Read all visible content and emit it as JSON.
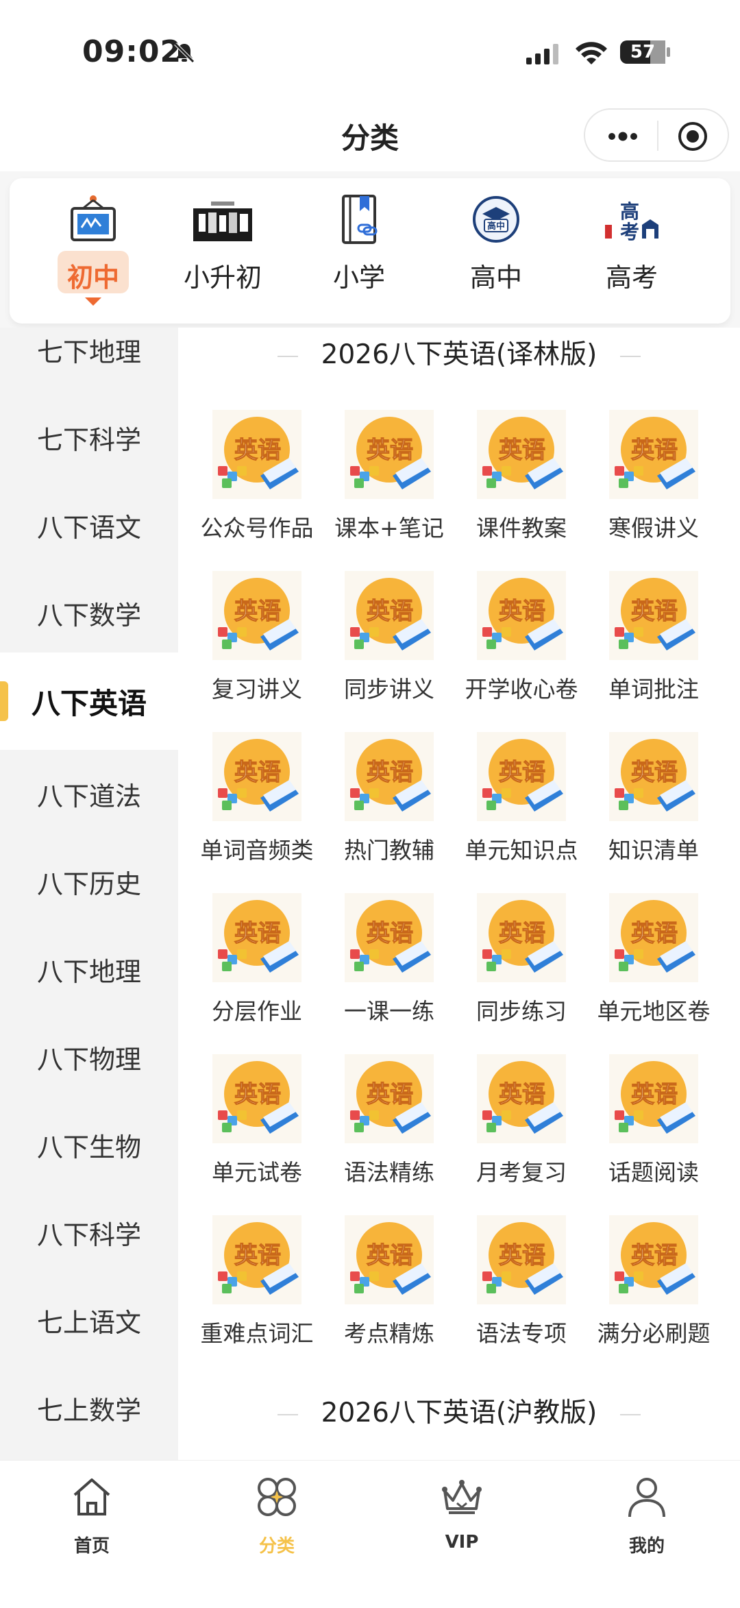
{
  "status": {
    "time": "09:02",
    "battery": "57"
  },
  "header": {
    "title": "分类"
  },
  "top_categories": [
    {
      "label": "初中",
      "active": true,
      "icon": "blackboard-icon"
    },
    {
      "label": "小升初",
      "active": false,
      "icon": "promo-banner-icon"
    },
    {
      "label": "小学",
      "active": false,
      "icon": "bookmark-book-icon"
    },
    {
      "label": "高中",
      "active": false,
      "icon": "high-school-badge-icon"
    },
    {
      "label": "高考",
      "active": false,
      "icon": "gaokao-logo-icon"
    }
  ],
  "sidebar": {
    "items": [
      "七下地理",
      "七下科学",
      "八下语文",
      "八下数学",
      "八下英语",
      "八下道法",
      "八下历史",
      "八下地理",
      "八下物理",
      "八下生物",
      "八下科学",
      "七上语文",
      "七上数学"
    ],
    "active_index": 4
  },
  "content": {
    "sections": [
      {
        "title": "2026八下英语(译林版)",
        "tiles": [
          "公众号作品",
          "课本+笔记",
          "课件教案",
          "寒假讲义",
          "复习讲义",
          "同步讲义",
          "开学收心卷",
          "单词批注",
          "单词音频类",
          "热门教辅",
          "单元知识点",
          "知识清单",
          "分层作业",
          "一课一练",
          "同步练习",
          "单元地区卷",
          "单元试卷",
          "语法精练",
          "月考复习",
          "话题阅读",
          "重难点词汇",
          "考点精炼",
          "语法专项",
          "满分必刷题"
        ]
      },
      {
        "title": "2026八下英语(沪教版)",
        "tiles": []
      }
    ],
    "tile_icon_text": "英语"
  },
  "tabbar": [
    {
      "label": "首页",
      "icon": "home-icon",
      "active": false
    },
    {
      "label": "分类",
      "icon": "category-icon",
      "active": true
    },
    {
      "label": "VIP",
      "icon": "crown-icon",
      "active": false
    },
    {
      "label": "我的",
      "icon": "profile-icon",
      "active": false
    }
  ],
  "colors": {
    "accent_orange": "#ee6a32",
    "accent_yellow": "#f5c24a",
    "tile_circle": "#f7b43a"
  }
}
